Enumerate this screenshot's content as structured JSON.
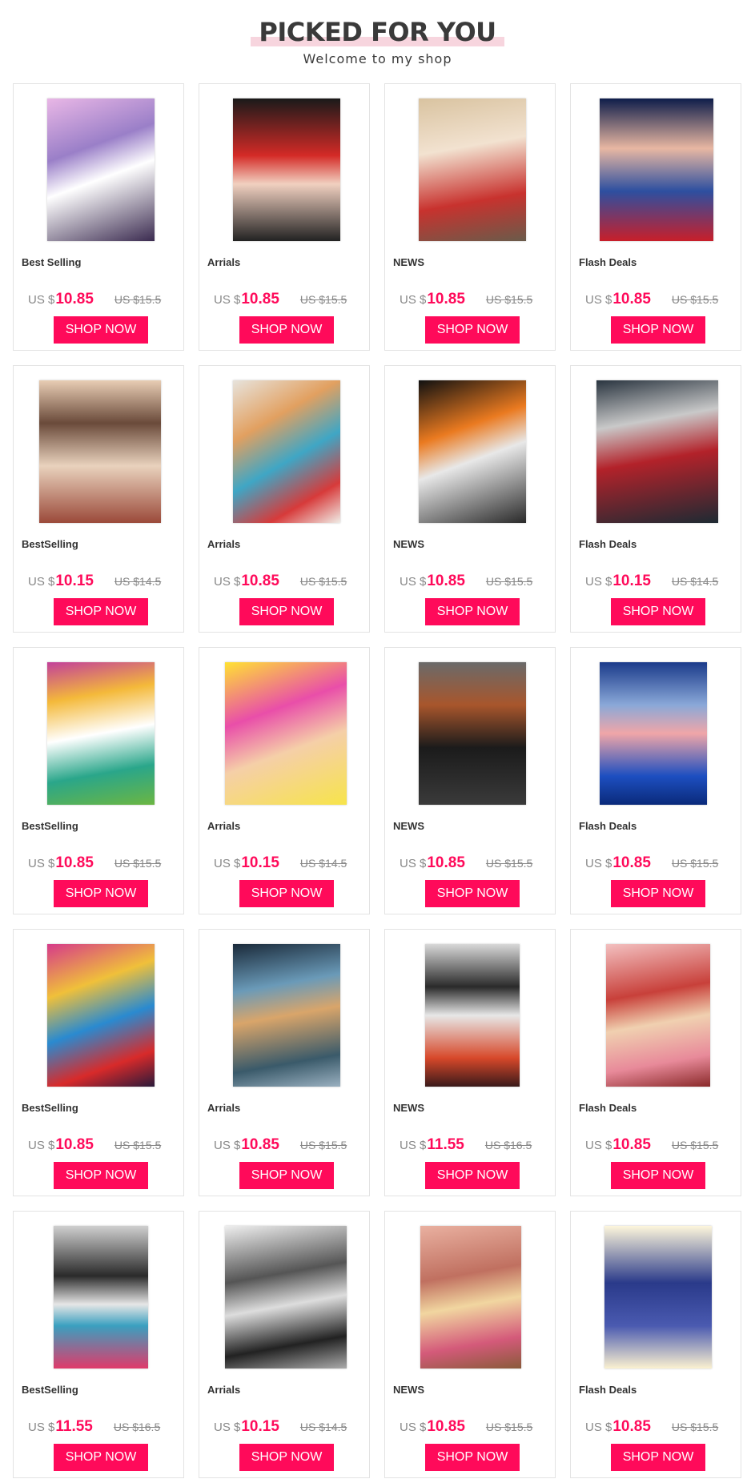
{
  "header": {
    "title": "PICKED FOR YOU",
    "subtitle": "Welcome to my shop"
  },
  "colors": {
    "accent": "#ff0a5a",
    "title_highlight": "#f7d5de"
  },
  "products": [
    {
      "category": "Best Selling",
      "currency": "US $",
      "price": "10.85",
      "old_price": "US $15.5",
      "cta": "SHOP NOW",
      "image": "ballerina-painting"
    },
    {
      "category": "Arrials",
      "currency": "US $",
      "price": "10.85",
      "old_price": "US $15.5",
      "cta": "SHOP NOW",
      "image": "woman-red-dress-bottle-painting"
    },
    {
      "category": "NEWS",
      "currency": "US $",
      "price": "10.85",
      "old_price": "US $15.5",
      "cta": "SHOP NOW",
      "image": "geisha-flowers-painting"
    },
    {
      "category": "Flash Deals",
      "currency": "US $",
      "price": "10.85",
      "old_price": "US $15.5",
      "cta": "SHOP NOW",
      "image": "woman-blue-outfit-wine-painting"
    },
    {
      "category": "BestSelling",
      "currency": "US $",
      "price": "10.15",
      "old_price": "US $14.5",
      "cta": "SHOP NOW",
      "image": "woman-back-butterflies-painting"
    },
    {
      "category": "Arrials",
      "currency": "US $",
      "price": "10.85",
      "old_price": "US $15.5",
      "cta": "SHOP NOW",
      "image": "colorful-face-portrait-painting"
    },
    {
      "category": "NEWS",
      "currency": "US $",
      "price": "10.85",
      "old_price": "US $15.5",
      "cta": "SHOP NOW",
      "image": "tiger-woman-painting"
    },
    {
      "category": "Flash Deals",
      "currency": "US $",
      "price": "10.15",
      "old_price": "US $14.5",
      "cta": "SHOP NOW",
      "image": "skeleton-couple-roses-painting"
    },
    {
      "category": "BestSelling",
      "currency": "US $",
      "price": "10.85",
      "old_price": "US $15.5",
      "cta": "SHOP NOW",
      "image": "floral-woman-butterfly-painting"
    },
    {
      "category": "Arrials",
      "currency": "US $",
      "price": "10.15",
      "old_price": "US $14.5",
      "cta": "SHOP NOW",
      "image": "pop-art-woman-sunglasses-painting"
    },
    {
      "category": "NEWS",
      "currency": "US $",
      "price": "10.85",
      "old_price": "US $15.5",
      "cta": "SHOP NOW",
      "image": "woman-black-dress-wine-painting"
    },
    {
      "category": "Flash Deals",
      "currency": "US $",
      "price": "10.85",
      "old_price": "US $15.5",
      "cta": "SHOP NOW",
      "image": "ballerina-swans-lake-painting"
    },
    {
      "category": "BestSelling",
      "currency": "US $",
      "price": "10.85",
      "old_price": "US $15.5",
      "cta": "SHOP NOW",
      "image": "pop-art-mona-lisa-painting"
    },
    {
      "category": "Arrials",
      "currency": "US $",
      "price": "10.85",
      "old_price": "US $15.5",
      "cta": "SHOP NOW",
      "image": "native-woman-wolf-painting"
    },
    {
      "category": "NEWS",
      "currency": "US $",
      "price": "11.55",
      "old_price": "US $16.5",
      "cta": "SHOP NOW",
      "image": "geisha-graffiti-painting"
    },
    {
      "category": "Flash Deals",
      "currency": "US $",
      "price": "10.85",
      "old_price": "US $15.5",
      "cta": "SHOP NOW",
      "image": "geisha-cherry-blossom-painting"
    },
    {
      "category": "BestSelling",
      "currency": "US $",
      "price": "11.55",
      "old_price": "US $16.5",
      "cta": "SHOP NOW",
      "image": "geisha-colorful-kimono-painting"
    },
    {
      "category": "Arrials",
      "currency": "US $",
      "price": "10.15",
      "old_price": "US $14.5",
      "cta": "SHOP NOW",
      "image": "steampunk-girl-painting"
    },
    {
      "category": "NEWS",
      "currency": "US $",
      "price": "10.85",
      "old_price": "US $15.5",
      "cta": "SHOP NOW",
      "image": "flower-fairy-painting"
    },
    {
      "category": "Flash Deals",
      "currency": "US $",
      "price": "10.85",
      "old_price": "US $15.5",
      "cta": "SHOP NOW",
      "image": "blue-roses-woman-painting"
    }
  ]
}
